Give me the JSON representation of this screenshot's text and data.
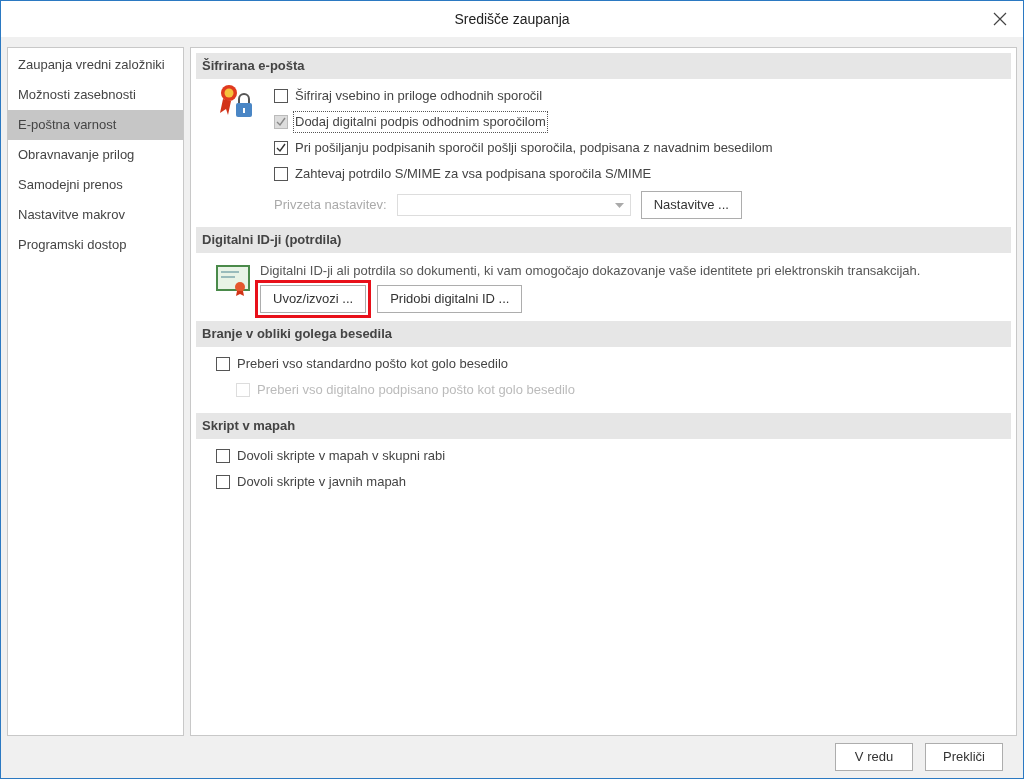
{
  "window": {
    "title": "Središče zaupanja"
  },
  "sidebar": {
    "items": [
      {
        "label": "Zaupanja vredni založniki",
        "selected": false
      },
      {
        "label": "Možnosti zasebnosti",
        "selected": false
      },
      {
        "label": "E-poštna varnost",
        "selected": true
      },
      {
        "label": "Obravnavanje prilog",
        "selected": false
      },
      {
        "label": "Samodejni prenos",
        "selected": false
      },
      {
        "label": "Nastavitve makrov",
        "selected": false
      },
      {
        "label": "Programski dostop",
        "selected": false
      }
    ]
  },
  "sections": [
    {
      "kind": "encrypted",
      "title": "Šifrirana e-pošta",
      "options": [
        {
          "label": "Šifriraj vsebino in priloge odhodnih sporočil",
          "checked": false,
          "disabled": false,
          "focused": false
        },
        {
          "label": "Dodaj digitalni podpis odhodnim sporočilom",
          "checked": true,
          "disabled": true,
          "focused": true
        },
        {
          "label": "Pri pošiljanju podpisanih sporočil pošlji sporočila, podpisana z navadnim besedilom",
          "checked": true,
          "disabled": false,
          "focused": false
        },
        {
          "label": "Zahtevaj potrdilo S/MIME za vsa podpisana sporočila S/MIME",
          "checked": false,
          "disabled": false,
          "focused": false
        }
      ],
      "default_setting": {
        "label": "Privzeta nastavitev:",
        "disabled": true
      },
      "settings_button": "Nastavitve ..."
    },
    {
      "kind": "ids",
      "title": "Digitalni ID-ji (potrdila)",
      "description": "Digitalni ID-ji ali potrdila so dokumenti, ki vam omogočajo dokazovanje vaše identitete pri elektronskih transakcijah.",
      "buttons": [
        {
          "label": "Uvoz/izvozi ...",
          "highlighted": true
        },
        {
          "label": "Pridobi digitalni ID ...",
          "highlighted": false
        }
      ]
    },
    {
      "kind": "checks",
      "title": "Branje v obliki golega besedila",
      "options": [
        {
          "label": "Preberi vso standardno pošto kot golo besedilo",
          "checked": false,
          "disabled": false,
          "focused": false,
          "children": [
            {
              "label": "Preberi vso digitalno podpisano pošto kot golo besedilo",
              "checked": false,
              "disabled": true,
              "focused": false
            }
          ]
        }
      ]
    },
    {
      "kind": "checks",
      "title": "Skript v mapah",
      "options": [
        {
          "label": "Dovoli skripte v mapah v skupni rabi",
          "checked": false,
          "disabled": false,
          "focused": false
        },
        {
          "label": "Dovoli skripte v javnih mapah",
          "checked": false,
          "disabled": false,
          "focused": false
        }
      ]
    }
  ],
  "buttons": [
    "V redu",
    "Prekliči"
  ]
}
